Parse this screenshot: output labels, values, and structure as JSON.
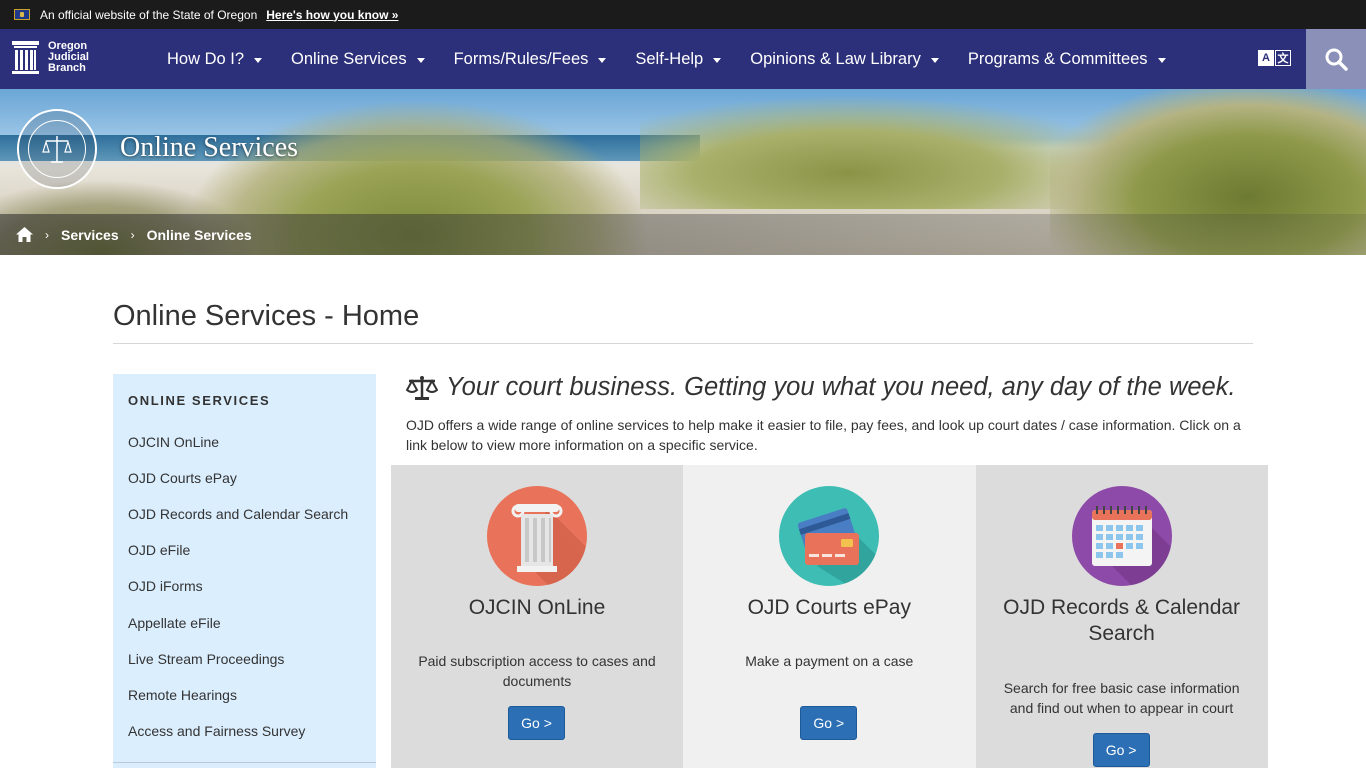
{
  "gov_banner": {
    "text": "An official website of the State of Oregon",
    "link": "Here's how you know »"
  },
  "logo": {
    "line1": "Oregon",
    "line2": "Judicial",
    "line3": "Branch"
  },
  "nav": {
    "items": [
      {
        "label": "How Do I?"
      },
      {
        "label": "Online Services"
      },
      {
        "label": "Forms/Rules/Fees"
      },
      {
        "label": "Self-Help"
      },
      {
        "label": "Opinions & Law Library"
      },
      {
        "label": "Programs & Committees"
      }
    ],
    "translate_a": "A",
    "translate_b": "文"
  },
  "hero": {
    "title": "Online Services",
    "breadcrumb": [
      "Services",
      "Online Services"
    ]
  },
  "page": {
    "title": "Online Services - Home",
    "tagline": "Your court business. Getting you what you need, any day of the week.",
    "intro": "OJD offers a wide range of online services to help make it easier to file, pay fees, and look up court dates / case information. Click on a link below to view more information on a specific service."
  },
  "sidebar": {
    "heading": "ONLINE SERVICES",
    "items": [
      "OJCIN OnLine",
      "OJD Courts ePay",
      "OJD Records and Calendar Search",
      "OJD eFile",
      "OJD iForms",
      "Appellate eFile",
      "Live Stream Proceedings",
      "Remote Hearings",
      "Access and Fairness Survey"
    ]
  },
  "cards": [
    {
      "title": "OJCIN OnLine",
      "desc": "Paid subscription access to cases and documents",
      "button": "Go >",
      "icon": "pillar-icon",
      "color": "#e8735a"
    },
    {
      "title": "OJD Courts ePay",
      "desc": "Make a payment on a case",
      "button": "Go >",
      "icon": "credit-card-icon",
      "color": "#3dbdb4"
    },
    {
      "title": "OJD Records & Calendar Search",
      "desc": "Search for free basic case information and find out when to appear in court",
      "button": "Go >",
      "icon": "calendar-icon",
      "color": "#8e4aa8"
    }
  ],
  "colors": {
    "nav_bg": "#2c2f79",
    "button_blue": "#2c6fb5",
    "sidebar_bg": "#dbeefe"
  }
}
